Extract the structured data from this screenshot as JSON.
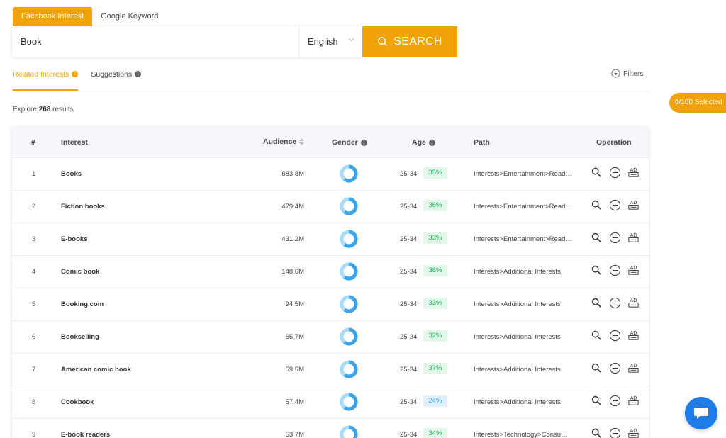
{
  "top_tabs": [
    {
      "label": "Facebook Interest",
      "active": true
    },
    {
      "label": "Google Keyword",
      "active": false
    }
  ],
  "search": {
    "value": "Book",
    "language": "English",
    "button_label": "SEARCH"
  },
  "sub_tabs": [
    {
      "label": "Related Interests",
      "active": true
    },
    {
      "label": "Suggestions",
      "active": false
    }
  ],
  "filters_label": "Filters",
  "selected": {
    "count": "0",
    "text": "/100 Selected"
  },
  "explore": {
    "prefix": "Explore",
    "count": "268",
    "suffix": "results"
  },
  "table": {
    "headers": {
      "num": "#",
      "interest": "Interest",
      "audience": "Audience",
      "gender": "Gender",
      "age": "Age",
      "path": "Path",
      "operation": "Operation"
    },
    "rows": [
      {
        "num": "1",
        "interest": "Books",
        "audience": "683.8M",
        "age": "25-34",
        "pct": "35%",
        "pct_color": "green",
        "path": "Interests>Entertainment>Reading"
      },
      {
        "num": "2",
        "interest": "Fiction books",
        "audience": "479.4M",
        "age": "25-34",
        "pct": "36%",
        "pct_color": "green",
        "path": "Interests>Entertainment>Reading"
      },
      {
        "num": "3",
        "interest": "E-books",
        "audience": "431.2M",
        "age": "25-34",
        "pct": "33%",
        "pct_color": "green",
        "path": "Interests>Entertainment>Reading"
      },
      {
        "num": "4",
        "interest": "Comic book",
        "audience": "148.6M",
        "age": "25-34",
        "pct": "38%",
        "pct_color": "green",
        "path": "Interests>Additional Interests"
      },
      {
        "num": "5",
        "interest": "Booking.com",
        "audience": "94.5M",
        "age": "25-34",
        "pct": "33%",
        "pct_color": "green",
        "path": "Interests>Additional Interests"
      },
      {
        "num": "6",
        "interest": "Bookselling",
        "audience": "65.7M",
        "age": "25-34",
        "pct": "32%",
        "pct_color": "green",
        "path": "Interests>Additional Interests"
      },
      {
        "num": "7",
        "interest": "American comic book",
        "audience": "59.5M",
        "age": "25-34",
        "pct": "37%",
        "pct_color": "green",
        "path": "Interests>Additional Interests"
      },
      {
        "num": "8",
        "interest": "Cookbook",
        "audience": "57.4M",
        "age": "25-34",
        "pct": "24%",
        "pct_color": "blue",
        "path": "Interests>Additional Interests"
      },
      {
        "num": "9",
        "interest": "E-book readers",
        "audience": "53.7M",
        "age": "25-34",
        "pct": "34%",
        "pct_color": "green",
        "path": "Interests>Technology>Consumer electronics"
      }
    ]
  },
  "icons": {
    "search": "magnifier-icon",
    "add": "plus-circle-icon",
    "ad": "ad-icon",
    "chat": "chat-bubble-icon"
  },
  "colors": {
    "accent": "#f0a30a",
    "pct_green_bg": "#e1f8ea",
    "pct_green_text": "#1cb157",
    "pct_blue_bg": "#e0f1fc",
    "pct_blue_text": "#33a6e8",
    "donut_dark": "#3ba3e9",
    "donut_light": "#a9dbf6",
    "chat_button": "#1e7be8"
  }
}
